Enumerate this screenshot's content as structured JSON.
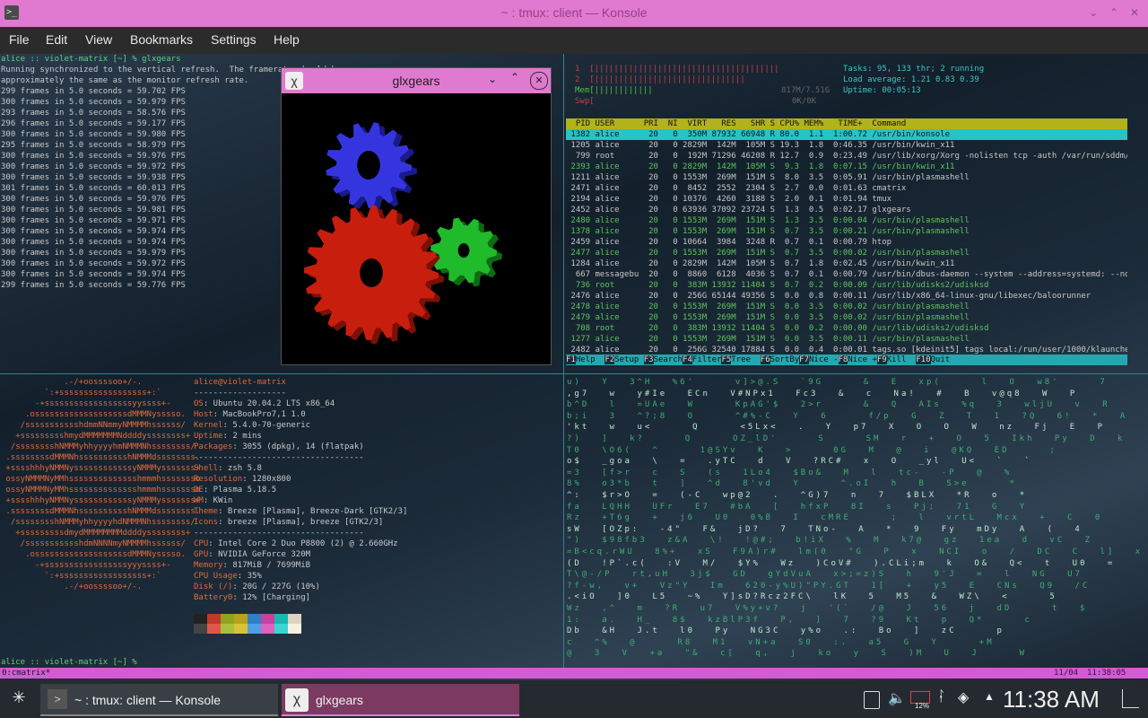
{
  "window": {
    "title": "~ : tmux: client — Konsole"
  },
  "menu": [
    "File",
    "Edit",
    "View",
    "Bookmarks",
    "Settings",
    "Help"
  ],
  "glxgears_pane": {
    "prompt": "alice :: violet-matrix [~] % glxgears",
    "msg1": "Running synchronized to the vertical refresh.  The framerate should be",
    "msg2": "approximately the same as the monitor refresh rate.",
    "frames": [
      "299 frames in 5.0 seconds = 59.702 FPS",
      "300 frames in 5.0 seconds = 59.979 FPS",
      "293 frames in 5.0 seconds = 58.576 FPS",
      "296 frames in 5.0 seconds = 59.177 FPS",
      "300 frames in 5.0 seconds = 59.980 FPS",
      "295 frames in 5.0 seconds = 58.979 FPS",
      "300 frames in 5.0 seconds = 59.976 FPS",
      "300 frames in 5.0 seconds = 59.972 FPS",
      "300 frames in 5.0 seconds = 59.938 FPS",
      "301 frames in 5.0 seconds = 60.013 FPS",
      "300 frames in 5.0 seconds = 59.976 FPS",
      "300 frames in 5.0 seconds = 59.981 FPS",
      "300 frames in 5.0 seconds = 59.971 FPS",
      "300 frames in 5.0 seconds = 59.974 FPS",
      "300 frames in 5.0 seconds = 59.974 FPS",
      "300 frames in 5.0 seconds = 59.979 FPS",
      "300 frames in 5.0 seconds = 59.972 FPS",
      "300 frames in 5.0 seconds = 59.974 FPS",
      "299 frames in 5.0 seconds = 59.776 FPS"
    ]
  },
  "htop": {
    "cpu1": "1  [||||||||||||||||||||||||||||||||||||||",
    "cpu2": "2  [|||||||||||||||||||||||||||||||",
    "mem": "Mem[||||||||||||",
    "mem_value": "817M/7.51G",
    "swp": "Swp[",
    "swp_value": "0K/0K",
    "tasks": "Tasks: 95, 133 thr; 2 running",
    "load": "Load average: 1.21 0.83 0.39",
    "uptime": "Uptime: 00:05:13",
    "header": "  PID USER      PRI  NI  VIRT   RES   SHR S CPU% MEM%   TIME+  Command",
    "rows": [
      " 1382 alice      20   0  350M 87932 66948 R 80.0  1.1  1:00.72 /usr/bin/konsole",
      " 1205 alice      20   0 2829M  142M  105M S 19.3  1.8  0:46.35 /usr/bin/kwin_x11",
      "  799 root       20   0  192M 71296 46208 R 12.7  0.9  0:23.49 /usr/lib/xorg/Xorg -nolisten tcp -auth /var/run/sddm/{2eac48",
      " 2393 alice      20   0 2829M  142M  105M S  9.3  1.8  0:07.15 /usr/bin/kwin_x11",
      " 1211 alice      20   0 1553M  269M  151M S  8.0  3.5  0:05.91 /usr/bin/plasmashell",
      " 2471 alice      20   0  8452  2552  2304 S  2.7  0.0  0:01.63 cmatrix",
      " 2194 alice      20   0 10376  4260  3188 S  2.0  0.1  0:01.94 tmux",
      " 2452 alice      20   0 63936 37092 23724 S  1.3  0.5  0:02.17 glxgears",
      " 2480 alice      20   0 1553M  269M  151M S  1.3  3.5  0:00.04 /usr/bin/plasmashell",
      " 1378 alice      20   0 1553M  269M  151M S  0.7  3.5  0:00.21 /usr/bin/plasmashell",
      " 2459 alice      20   0 10664  3984  3248 R  0.7  0.1  0:00.79 htop",
      " 2477 alice      20   0 1553M  269M  151M S  0.7  3.5  0:00.02 /usr/bin/plasmashell",
      " 1284 alice      20   0 2829M  142M  105M S  0.7  1.8  0:02.45 /usr/bin/kwin_x11",
      "  667 messagebu  20   0  8860  6128  4036 S  0.7  0.1  0:00.79 /usr/bin/dbus-daemon --system --address=systemd: --nofork --",
      "  736 root       20   0  383M 13932 11404 S  0.7  0.2  0:00.09 /usr/lib/udisks2/udisksd",
      " 2476 alice      20   0  256G 65144 49356 S  0.0  0.8  0:00.11 /usr/lib/x86_64-linux-gnu/libexec/baloorunner",
      " 2478 alice      20   0 1553M  269M  151M S  0.0  3.5  0:00.02 /usr/bin/plasmashell",
      " 2479 alice      20   0 1553M  269M  151M S  0.0  3.5  0:00.02 /usr/bin/plasmashell",
      "  708 root       20   0  383M 13932 11404 S  0.0  0.2  0:00.00 /usr/lib/udisks2/udisksd",
      " 1277 alice      20   0 1553M  269M  151M S  0.0  3.5  0:00.11 /usr/bin/plasmashell",
      " 2482 alice      20   0  256G 32540 17884 S  0.0  0.4  0:00.01 tags.so [kdeinit5] tags local:/run/user/1000/klauncherimYvZc"
    ],
    "fkeys": [
      {
        "k": "F1",
        "l": "Help  "
      },
      {
        "k": "F2",
        "l": "Setup "
      },
      {
        "k": "F3",
        "l": "Search"
      },
      {
        "k": "F4",
        "l": "Filter"
      },
      {
        "k": "F5",
        "l": "Tree  "
      },
      {
        "k": "F6",
        "l": "SortBy"
      },
      {
        "k": "F7",
        "l": "Nice -"
      },
      {
        "k": "F8",
        "l": "Nice +"
      },
      {
        "k": "F9",
        "l": "Kill  "
      },
      {
        "k": "F10",
        "l": "Quit  "
      }
    ]
  },
  "neofetch": {
    "logo": [
      "             .-/+oossssoo+/-.",
      "         `:+ssssssssssssssssss+:`",
      "       -+ssssssssssssssssssyyssss+-",
      "     .osssssssssssssssssssdMMMNysssso.",
      "    /ssssssssssshdmmNNmmyNMMMMhssssss/",
      "   +ssssssssshmydMMMMMMMNddddyssssssss+",
      "  /sssssssshNMMMyhhyyyyhmNMMMNhssssssss/",
      " .ssssssssdMMMNhsssssssssshNMMMdssssssss.",
      " +sssshhhyNMMNyssssssssssssyNMMMysssssss+",
      " ossyNMMMNyMMhsssssssssssssshmmmhssssssso",
      " ossyNMMMNyMMhsssssssssssssshmmmhssssssso",
      " +sssshhhyNMMNyssssssssssssyNMMMysssssss+",
      " .ssssssssdMMMNhsssssssssshNMMMdssssssss.",
      "  /sssssssshNMMMyhhyyyyhdNMMMNhssssssss/",
      "   +sssssssssdmydMMMMMMMMddddyssssssss+",
      "    /ssssssssssshdmNNNNmyNMMMMhssssss/",
      "     .osssssssssssssssssssdMMMNysssso.",
      "       -+sssssssssssssssssyyyssss+-",
      "         `:+ssssssssssssssssss+:`",
      "             .-/+oossssoo+/-."
    ],
    "user_host": "alice@violet-matrix",
    "sep": "-------------------",
    "info": [
      {
        "k": "OS",
        "v": ": Ubuntu 20.04.2 LTS x86_64"
      },
      {
        "k": "Host",
        "v": ": MacBookPro7,1 1.0"
      },
      {
        "k": "Kernel",
        "v": ": 5.4.0-70-generic"
      },
      {
        "k": "Uptime",
        "v": ": 2 mins"
      },
      {
        "k": "Packages",
        "v": ": 3055 (dpkg), 14 (flatpak)"
      }
    ],
    "sep2": "-----------------------------------",
    "info2": [
      {
        "k": "Shell",
        "v": ": zsh 5.8"
      },
      {
        "k": "Resolution",
        "v": ": 1280x800"
      },
      {
        "k": "DE",
        "v": ": Plasma 5.18.5"
      },
      {
        "k": "WM",
        "v": ": KWin"
      },
      {
        "k": "Theme",
        "v": ": Breeze [Plasma], Breeze-Dark [GTK2/3]"
      },
      {
        "k": "Icons",
        "v": ": breeze [Plasma], breeze [GTK2/3]"
      }
    ],
    "sep3": "-----------------------------------",
    "info3": [
      {
        "k": "CPU",
        "v": ": Intel Core 2 Duo P8800 (2) @ 2.660GHz"
      },
      {
        "k": "GPU",
        "v": ": NVIDIA GeForce 320M"
      },
      {
        "k": "Memory",
        "v": ": 817MiB / 7699MiB"
      },
      {
        "k": "CPU Usage",
        "v": ": 35%"
      },
      {
        "k": "Disk (/)",
        "v": ": 20G / 227G (10%)"
      },
      {
        "k": "Battery0",
        "v": ": 12% [Charging]"
      }
    ],
    "palette_top": [
      "#222222",
      "#c0392b",
      "#8fa31c",
      "#b8a21a",
      "#2f7fc7",
      "#c4439f",
      "#1ab6b0",
      "#dcd3c0"
    ],
    "palette_bottom": [
      "#444444",
      "#e0574a",
      "#a7c23a",
      "#d9c13a",
      "#4f9fe7",
      "#de63bf",
      "#3ad6d0",
      "#f6f0e0"
    ],
    "prompt": "alice :: violet-matrix [~] %"
  },
  "tmux": {
    "window": "0:cmatrix*",
    "date": "11/04",
    "time": "11:38:05"
  },
  "glxgears_window": {
    "title": "glxgears"
  },
  "matrix_cols": [
    "u) Y 3^H %6'  v]>@.S `9G  & E xp(  l O w8'  7",
    ",g7 w y#Ie ECn V#NPx1 Fc3 & c Na! # B v@q8 W P",
    "b^D l =UAe W  KpAG'$ 2>r  & Q AIs %q 3 wljU v R",
    "b;i 3 ^?;8 O  ^#%-C Y 6  f/p G Z T 1 ?Q 6! * A",
    "'kt w u<  Q  <5Lx< . Y p7 X O O W nz Fj E P",
    "?) ] k?  Q  OZ_lD'  S  SM r + O 5 Ikh Py D k",
    "T0 \\O6( ^  1@SYv K >  0G M @ i @KQ ED  ;",
    "o$ _goa \\ = .yTC d V ?RC# x O _yl U< ` `",
    "=3 [f>r c S (s 1Lo4 $Bo& M l tc- -P @ %",
    "8% o3*b t ] ^d 8'vd Y  ^.oI h B S>e  *",
    "^: $r>O = (-C wp@2 . ^G)7 n 7 $BLX *R o *",
    "fa LQHH UFr E7 #bA [ hfxP 8I s Pj; 71 G Y",
    "Rz +T6g + j6 U0 0%B I cMRE  ; l vrtL Mcx + C 0",
    "sW [OZp: -4\" F& jD? 7 TNo- A * 9 Fy mDy A ( 4",
    "\") $98fb3 z&A \\! !@#; b!iX % M k7@ gz 1ea d vC Z",
    "=B<cq.rWU 8%+ xS F9A)r# lm(0 \"G P x NCI o / DC C l] x",
    "(D !P`.c( :V M/ $Y% Wz )CoV# ).CLi;m k O& Q< t U0 =",
    "T\\@-/P rt,uH 3j$ GD gYdVuA x>;=z)S h 9'J = l NG U7",
    "?f-w, v+ Vz\"Y Im 620-y%U)\"PY.GT 1[ + y5 E CNs Q9 /C",
    ".<iO ]0 L5 ~% Y]sD?Rcz2FC\\ lK 5 M5 & WZ\\ <  5",
    "Wz ,^ m ?R u7 V%y+v? j '(` /@ J 56 j dD  t $",
    "1: a. H_ 8$ kzBlP3f P, ] 7 ?9 Kt p Q*  c",
    "Db &H J.t l0 Py NG3C y%o .: Bo ] zC  p",
    "c ^% @  R8 M1 vN+a S0 :. a5 G Y  +M",
    "@ 3 V +a \"& c[ q, j ko y S )M U J  W"
  ],
  "taskbar": {
    "task1": "~ : tmux: client — Konsole",
    "task2": "glxgears",
    "clock": "11:38 AM",
    "battery": "12%"
  }
}
